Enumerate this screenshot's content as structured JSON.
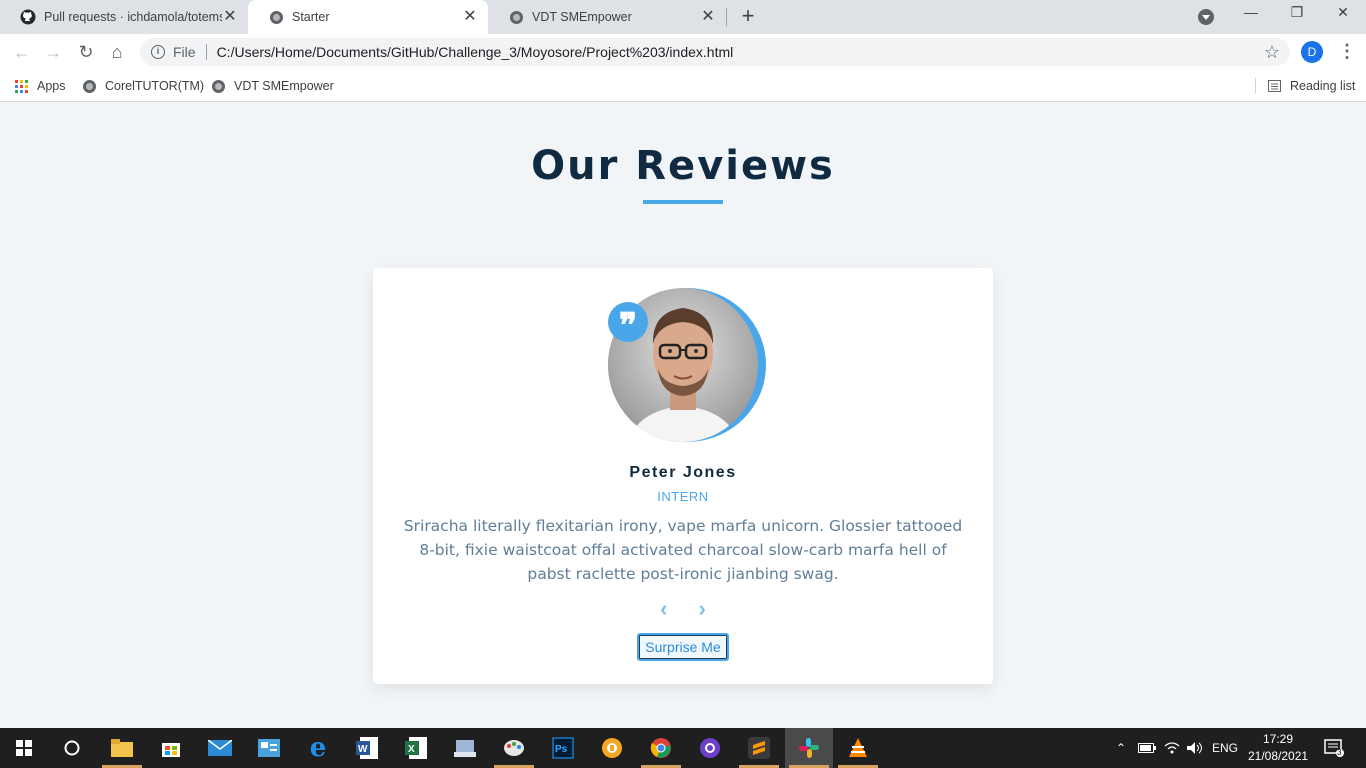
{
  "browser": {
    "tabs": [
      {
        "title": "Pull requests · ichdamola/totems",
        "icon": "github-icon",
        "active": false
      },
      {
        "title": "Starter",
        "icon": "globe-icon",
        "active": true
      },
      {
        "title": "VDT SMEmpower",
        "icon": "globe-icon",
        "active": false
      }
    ],
    "window_controls": {
      "minimize": "—",
      "restore": "❐",
      "close": "✕"
    },
    "address": {
      "scheme": "File",
      "url": "C:/Users/Home/Documents/GitHub/Challenge_3/Moyosore/Project%203/index.html"
    },
    "profile_initial": "D",
    "bookmarks": [
      {
        "label": "Apps",
        "icon": "apps-grid-icon"
      },
      {
        "label": "CorelTUTOR(TM)",
        "icon": "globe-icon"
      },
      {
        "label": "VDT SMEmpower",
        "icon": "globe-icon"
      }
    ],
    "reading_list": "Reading list"
  },
  "page": {
    "heading": "Our Reviews",
    "review": {
      "name": "Peter Jones",
      "job": "INTERN",
      "text": "Sriracha literally flexitarian irony, vape marfa unicorn. Glossier tattooed 8-bit, fixie waistcoat offal activated charcoal slow-carb marfa hell of pabst raclette post-ironic jianbing swag.",
      "quote_glyph": "❞",
      "prev_glyph": "‹",
      "next_glyph": "›",
      "random_button": "Surprise Me"
    },
    "colors": {
      "primary": "#49a6e9",
      "heading": "#102a42",
      "text": "#617d98",
      "background": "#f1f5f8"
    }
  },
  "taskbar": {
    "language": "ENG",
    "time": "17:29",
    "date": "21/08/2021",
    "notification_count": "3"
  }
}
